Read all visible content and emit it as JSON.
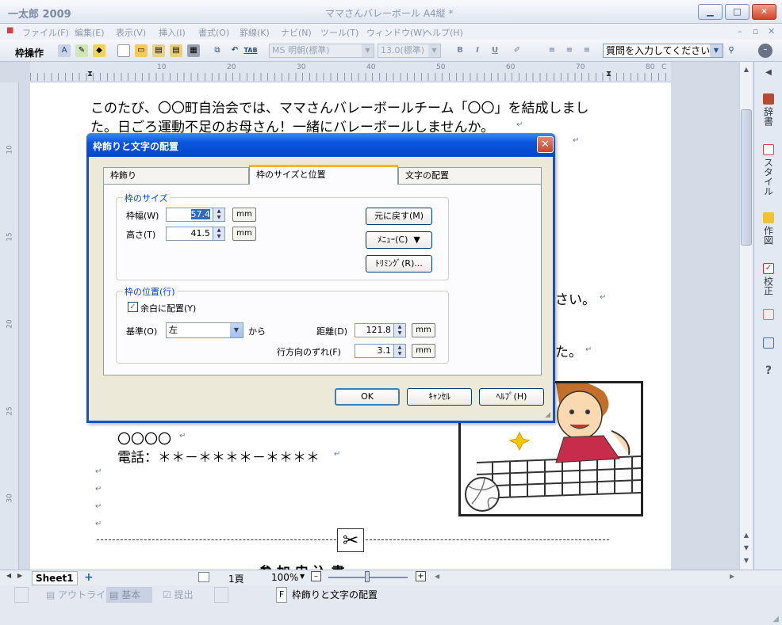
{
  "window": {
    "app_title": "一太郎 2009",
    "doc_title": "ママさんバレーボール A4縦 *",
    "minimize": "▁",
    "maximize": "□",
    "close": "✕"
  },
  "menu": [
    "ファイル(F)",
    "編集(E)",
    "表示(V)",
    "挿入(I)",
    "書式(O)",
    "罫線(K)",
    "ナビ(N)",
    "ツール(T)",
    "ウィンドウ(W)",
    "ヘルプ(H)"
  ],
  "toolbar": {
    "label": "枠操作",
    "font_name": "MS 明朝(標準)",
    "font_size": "13.0(標準)",
    "bold": "B",
    "italic": "I",
    "underline": "U",
    "tab": "TAB",
    "question_placeholder": "質問を入力してください"
  },
  "ruler": {
    "h_ticks": [
      "10",
      "20",
      "30",
      "40",
      "50",
      "60",
      "70",
      "80"
    ],
    "v_ticks": [
      "10",
      "15",
      "20",
      "25",
      "30"
    ],
    "c_mark": "C"
  },
  "document": {
    "line1": "このたび、〇〇町自治会では、ママさんバレーボールチーム「〇〇」を結成しまし",
    "line2": "た。日ごろ運動不足のお母さん！一緒にバレーボールしませんか。",
    "frag1": "さい。",
    "frag2": "た。",
    "contact_name": "〇〇〇〇",
    "contact_phone": "電話：＊＊－＊＊＊＊－＊＊＊＊",
    "partial_heading": "参 加 申 込 書",
    "return_mark": "↵"
  },
  "side_panel": [
    "辞書",
    "スタイル",
    "作図",
    "校正"
  ],
  "help_mark": "?",
  "tabs_row": {
    "sheet": "Sheet1",
    "add": "+",
    "page": "1頁",
    "zoom": "100%"
  },
  "status": {
    "outline": "アウトライン",
    "basic": "基本",
    "submit": "提出",
    "key": "F",
    "message": "枠飾りと文字の配置"
  },
  "dialog": {
    "title": "枠飾りと文字の配置",
    "tabs": [
      "枠飾り",
      "枠のサイズと位置",
      "文字の配置"
    ],
    "size_group": "枠のサイズ",
    "width_label": "枠幅(W)",
    "width_value": "57.4",
    "height_label": "高さ(T)",
    "height_value": "41.5",
    "unit": "mm",
    "reset_button": "元に戻す(M)",
    "menu_button": "ﾒﾆｭｰ(C)",
    "trimming_button": "ﾄﾘﾐﾝｸﾞ(R)...",
    "pos_group": "枠の位置(行)",
    "margin_check": "余白に配置(Y)",
    "base_label": "基準(O)",
    "base_value": "左",
    "kara": "から",
    "dist_label": "距離(D)",
    "dist_value": "121.8",
    "offset_label": "行方向のずれ(F)",
    "offset_value": "3.1",
    "ok": "OK",
    "cancel": "ｷｬﾝｾﾙ",
    "help": "ﾍﾙﾌﾟ(H)"
  },
  "colors": {
    "dialog_title": "#0a55de",
    "tab_highlight": "#f5b532",
    "group_label": "#0046d5"
  }
}
